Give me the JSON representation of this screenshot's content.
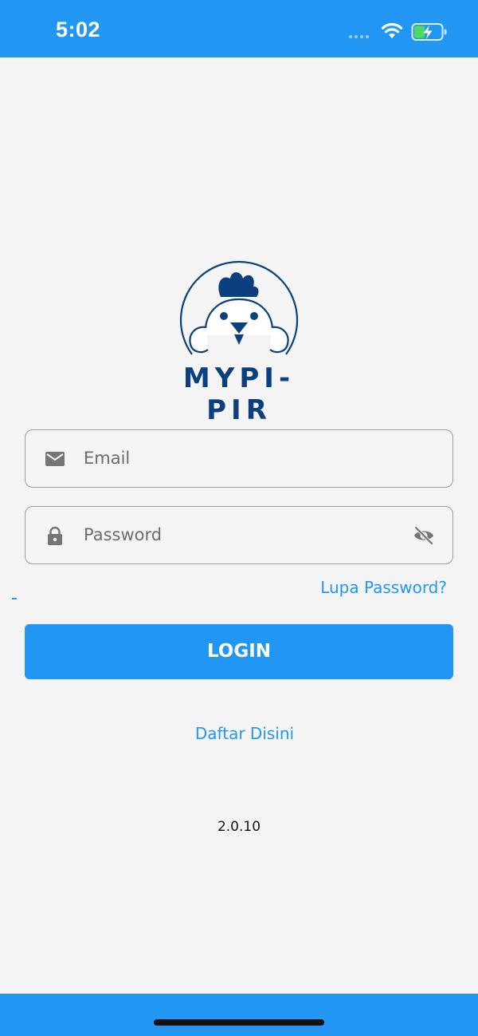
{
  "status_bar": {
    "time": "5:02",
    "icons": [
      "signal-dots-icon",
      "wifi-icon",
      "battery-charging-icon"
    ]
  },
  "logo": {
    "text": "MYPI-PIR",
    "icon": "chicken-mascot-icon"
  },
  "login_form": {
    "email": {
      "placeholder": "Email",
      "value": "",
      "icon": "mail-icon"
    },
    "password": {
      "placeholder": "Password",
      "value": "",
      "icon": "lock-icon",
      "toggle_icon": "eye-off-icon"
    },
    "forgot_password_label": "Lupa Password?",
    "login_button_label": "LOGIN",
    "signup_label": "Daftar Disini"
  },
  "version": "2.0.10",
  "colors": {
    "primary": "#2196f3",
    "logo_navy": "#0c3f7d",
    "background": "#f4f4f4"
  }
}
